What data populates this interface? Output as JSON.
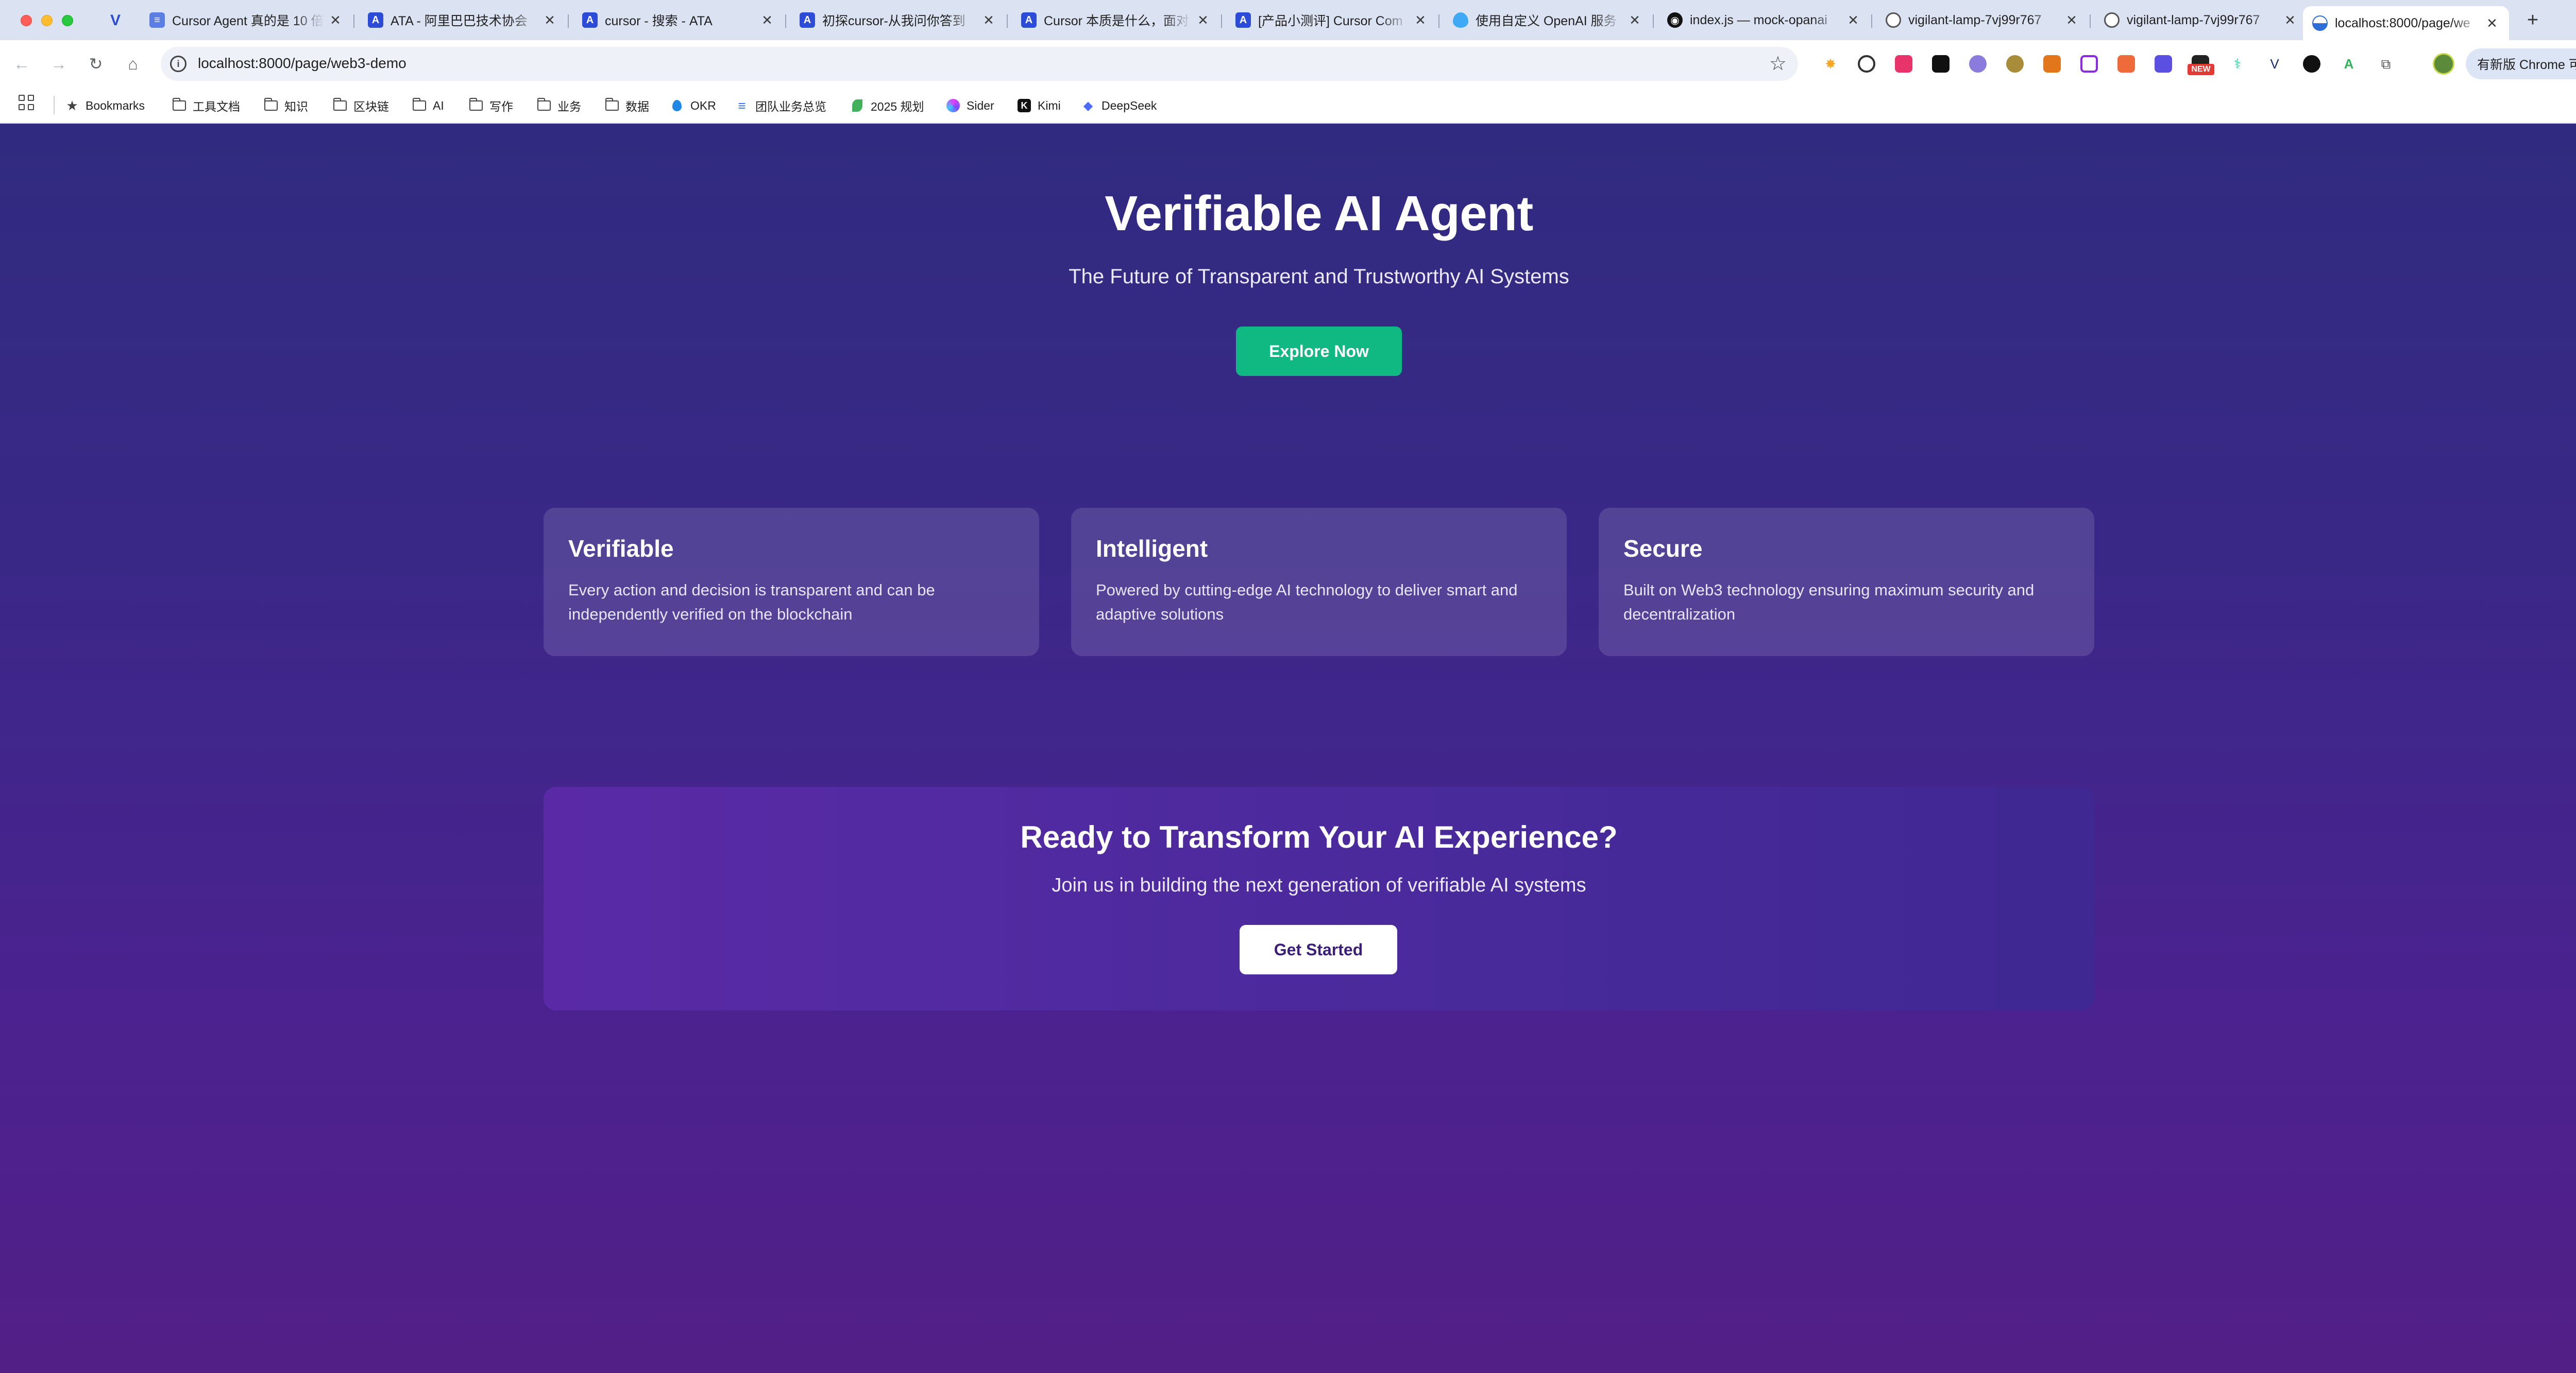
{
  "browser": {
    "tabs": [
      {
        "title": "Cursor Agent 真的是 10 倍",
        "favicon": "ata-doc-icon",
        "color": "#5b7fe0"
      },
      {
        "title": "ATA - 阿里巴巴技术协会",
        "favicon": "ata-icon",
        "color": "#2c4bd6"
      },
      {
        "title": "cursor - 搜索 - ATA",
        "favicon": "ata-icon",
        "color": "#2c4bd6"
      },
      {
        "title": "初探cursor-从我问你答到",
        "favicon": "ata-icon",
        "color": "#2c4bd6"
      },
      {
        "title": "Cursor 本质是什么，面对",
        "favicon": "ata-icon",
        "color": "#2c4bd6"
      },
      {
        "title": "[产品小测评] Cursor Com",
        "favicon": "ata-icon",
        "color": "#2c4bd6"
      },
      {
        "title": "使用自定义 OpenAI 服务",
        "favicon": "drop-icon",
        "color": "#3fa9f5"
      },
      {
        "title": "index.js — mock-opanai",
        "favicon": "github-icon",
        "color": "#111111"
      },
      {
        "title": "vigilant-lamp-7vj99r767",
        "favicon": "globe-icon",
        "color": "#555555"
      },
      {
        "title": "vigilant-lamp-7vj99r767",
        "favicon": "globe-icon",
        "color": "#555555"
      },
      {
        "title": "localhost:8000/page/we",
        "favicon": "globe-icon",
        "color": "#2c6fd6",
        "active": true
      }
    ],
    "address": {
      "url": "localhost:8000/page/web3-demo"
    },
    "update_label": "有新版 Chrome 可用",
    "bookmarks": [
      {
        "label": "Bookmarks",
        "icon": "star-icon"
      },
      {
        "label": "工具文档",
        "icon": "folder-icon"
      },
      {
        "label": "知识",
        "icon": "folder-icon"
      },
      {
        "label": "区块链",
        "icon": "folder-icon"
      },
      {
        "label": "AI",
        "icon": "folder-icon"
      },
      {
        "label": "写作",
        "icon": "folder-icon"
      },
      {
        "label": "业务",
        "icon": "folder-icon"
      },
      {
        "label": "数据",
        "icon": "folder-icon"
      },
      {
        "label": "OKR",
        "icon": "drop-icon"
      },
      {
        "label": "团队业务总览",
        "icon": "ata-doc-icon"
      },
      {
        "label": "2025 规划",
        "icon": "leaf-icon"
      },
      {
        "label": "Sider",
        "icon": "sider-icon"
      },
      {
        "label": "Kimi",
        "icon": "kimi-icon"
      },
      {
        "label": "DeepSeek",
        "icon": "deepseek-icon"
      }
    ],
    "extensions_new_badge": "NEW"
  },
  "page": {
    "hero": {
      "title": "Verifiable AI Agent",
      "subtitle": "The Future of Transparent and Trustworthy AI Systems",
      "button": "Explore Now"
    },
    "features": [
      {
        "title": "Verifiable",
        "text": "Every action and decision is transparent and can be independently verified on the blockchain"
      },
      {
        "title": "Intelligent",
        "text": "Powered by cutting-edge AI technology to deliver smart and adaptive solutions"
      },
      {
        "title": "Secure",
        "text": "Built on Web3 technology ensuring maximum security and decentralization"
      }
    ],
    "cta": {
      "title": "Ready to Transform Your AI Experience?",
      "subtitle": "Join us in building the next generation of verifiable AI systems",
      "button": "Get Started"
    },
    "colors": {
      "primary_button": "#10b981",
      "background_top": "#302b80",
      "background_bottom": "#521f86"
    }
  }
}
